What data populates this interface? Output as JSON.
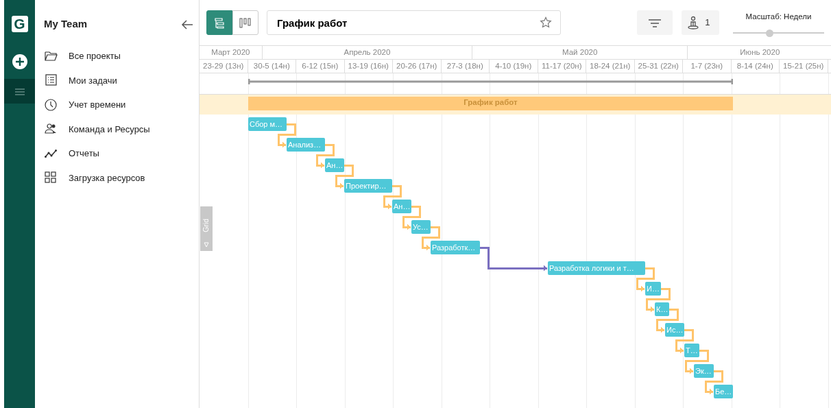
{
  "rail": {
    "logo": "G",
    "menu_button": {
      "selected": true
    }
  },
  "sidebar": {
    "title": "My Team",
    "items": [
      {
        "label": "Все проекты"
      },
      {
        "label": "Мои задачи"
      },
      {
        "label": "Учет времени"
      },
      {
        "label": "Команда и Ресурсы"
      },
      {
        "label": "Отчеты"
      },
      {
        "label": "Загрузка ресурсов"
      }
    ]
  },
  "toolbar": {
    "views": [
      {
        "selected": true
      },
      {
        "selected": false
      }
    ],
    "project_title": {
      "value": "График работ",
      "favorite": false
    },
    "resources_count": "1",
    "scale": {
      "label": "Масштаб: Недели",
      "level": 0.4
    }
  },
  "timeline": {
    "months": [
      "Март 2020",
      "Апрель 2020",
      "Май 2020",
      "Июнь 2020"
    ],
    "weeks": [
      "23-29 (13н)",
      "30-5 (14н)",
      "6-12 (15н)",
      "13-19 (16н)",
      "20-26 (17н)",
      "27-3 (18н)",
      "4-10 (19н)",
      "11-17 (20н)",
      "18-24 (21н)",
      "25-31 (22н)",
      "1-7 (23н)",
      "8-14 (24н)",
      "15-21 (25н)"
    ]
  },
  "summary": {
    "label": "График работ"
  },
  "tasks": [
    {
      "label": "Сбор м…"
    },
    {
      "label": "Анализ…"
    },
    {
      "label": "Ан…"
    },
    {
      "label": "Проектир…"
    },
    {
      "label": "Ан…"
    },
    {
      "label": "Ус…"
    },
    {
      "label": "Разработк…"
    },
    {
      "label": "Разработка логики и т…"
    },
    {
      "label": "И…"
    },
    {
      "label": "К…"
    },
    {
      "label": "Ис…"
    },
    {
      "label": "Т…"
    },
    {
      "label": "Эк…"
    },
    {
      "label": "Бе…"
    }
  ],
  "links": [
    {
      "color": "#ffc46b"
    },
    {
      "color": "#ffc46b"
    },
    {
      "color": "#ffc46b"
    },
    {
      "color": "#ffc46b"
    },
    {
      "color": "#ffc46b"
    },
    {
      "color": "#ffc46b"
    },
    {
      "color": "#7a6fc0"
    },
    {
      "color": "#ffc46b"
    },
    {
      "color": "#ffc46b"
    },
    {
      "color": "#ffc46b"
    },
    {
      "color": "#ffc46b"
    },
    {
      "color": "#ffc46b"
    },
    {
      "color": "#ffc46b"
    }
  ],
  "grid_tab": {
    "label": "Grid"
  }
}
